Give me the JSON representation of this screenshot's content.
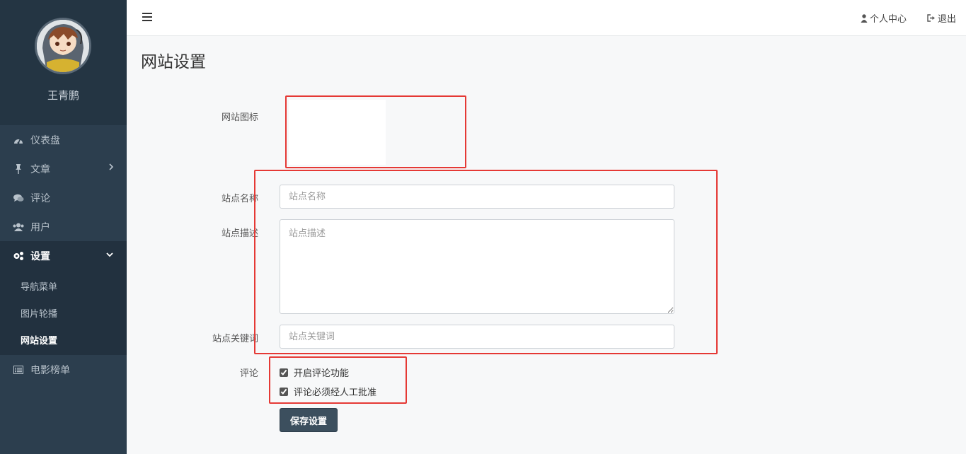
{
  "sidebar": {
    "username": "王青鹏",
    "items": [
      {
        "label": "仪表盘",
        "icon": "dashboard-icon"
      },
      {
        "label": "文章",
        "icon": "pin-icon"
      },
      {
        "label": "评论",
        "icon": "comments-icon"
      },
      {
        "label": "用户",
        "icon": "users-icon"
      },
      {
        "label": "设置",
        "icon": "gears-icon"
      },
      {
        "label": "电影榜单",
        "icon": "list-icon"
      }
    ],
    "settings_sub": [
      {
        "label": "导航菜单"
      },
      {
        "label": "图片轮播"
      },
      {
        "label": "网站设置"
      }
    ]
  },
  "topbar": {
    "profile_label": "个人中心",
    "logout_label": "退出"
  },
  "main": {
    "title": "网站设置",
    "logo_label": "网站图标",
    "site_name_label": "站点名称",
    "site_name_placeholder": "站点名称",
    "site_name_value": "",
    "site_desc_label": "站点描述",
    "site_desc_placeholder": "站点描述",
    "site_desc_value": "",
    "keywords_label": "站点关键词",
    "keywords_placeholder": "站点关键词",
    "keywords_value": "",
    "comments_label": "评论",
    "enable_comments_label": "开启评论功能",
    "enable_comments_checked": true,
    "approve_comments_label": "评论必须经人工批准",
    "approve_comments_checked": true,
    "save_label": "保存设置"
  },
  "colors": {
    "sidebar_bg": "#2c3e4e",
    "highlight": "#e53935",
    "button_bg": "#3c4f5e"
  }
}
